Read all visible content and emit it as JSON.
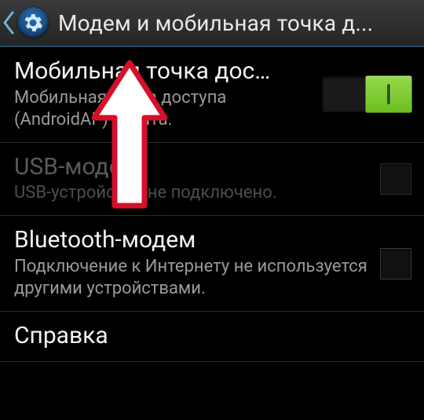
{
  "header": {
    "title": "Модем и мобильная точка д..."
  },
  "rows": {
    "hotspot": {
      "title": "Мобильная точка дос…",
      "subtitle": "Мобильная точка доступа (AndroidAP) занята.",
      "switch_on": true
    },
    "usb": {
      "title": "USB-модем",
      "subtitle": "USB-устройство не подключено."
    },
    "bluetooth": {
      "title": "Bluetooth-модем",
      "subtitle": "Подключение к Интернету не используется другими устройствами."
    },
    "help": {
      "title": "Справка"
    }
  }
}
